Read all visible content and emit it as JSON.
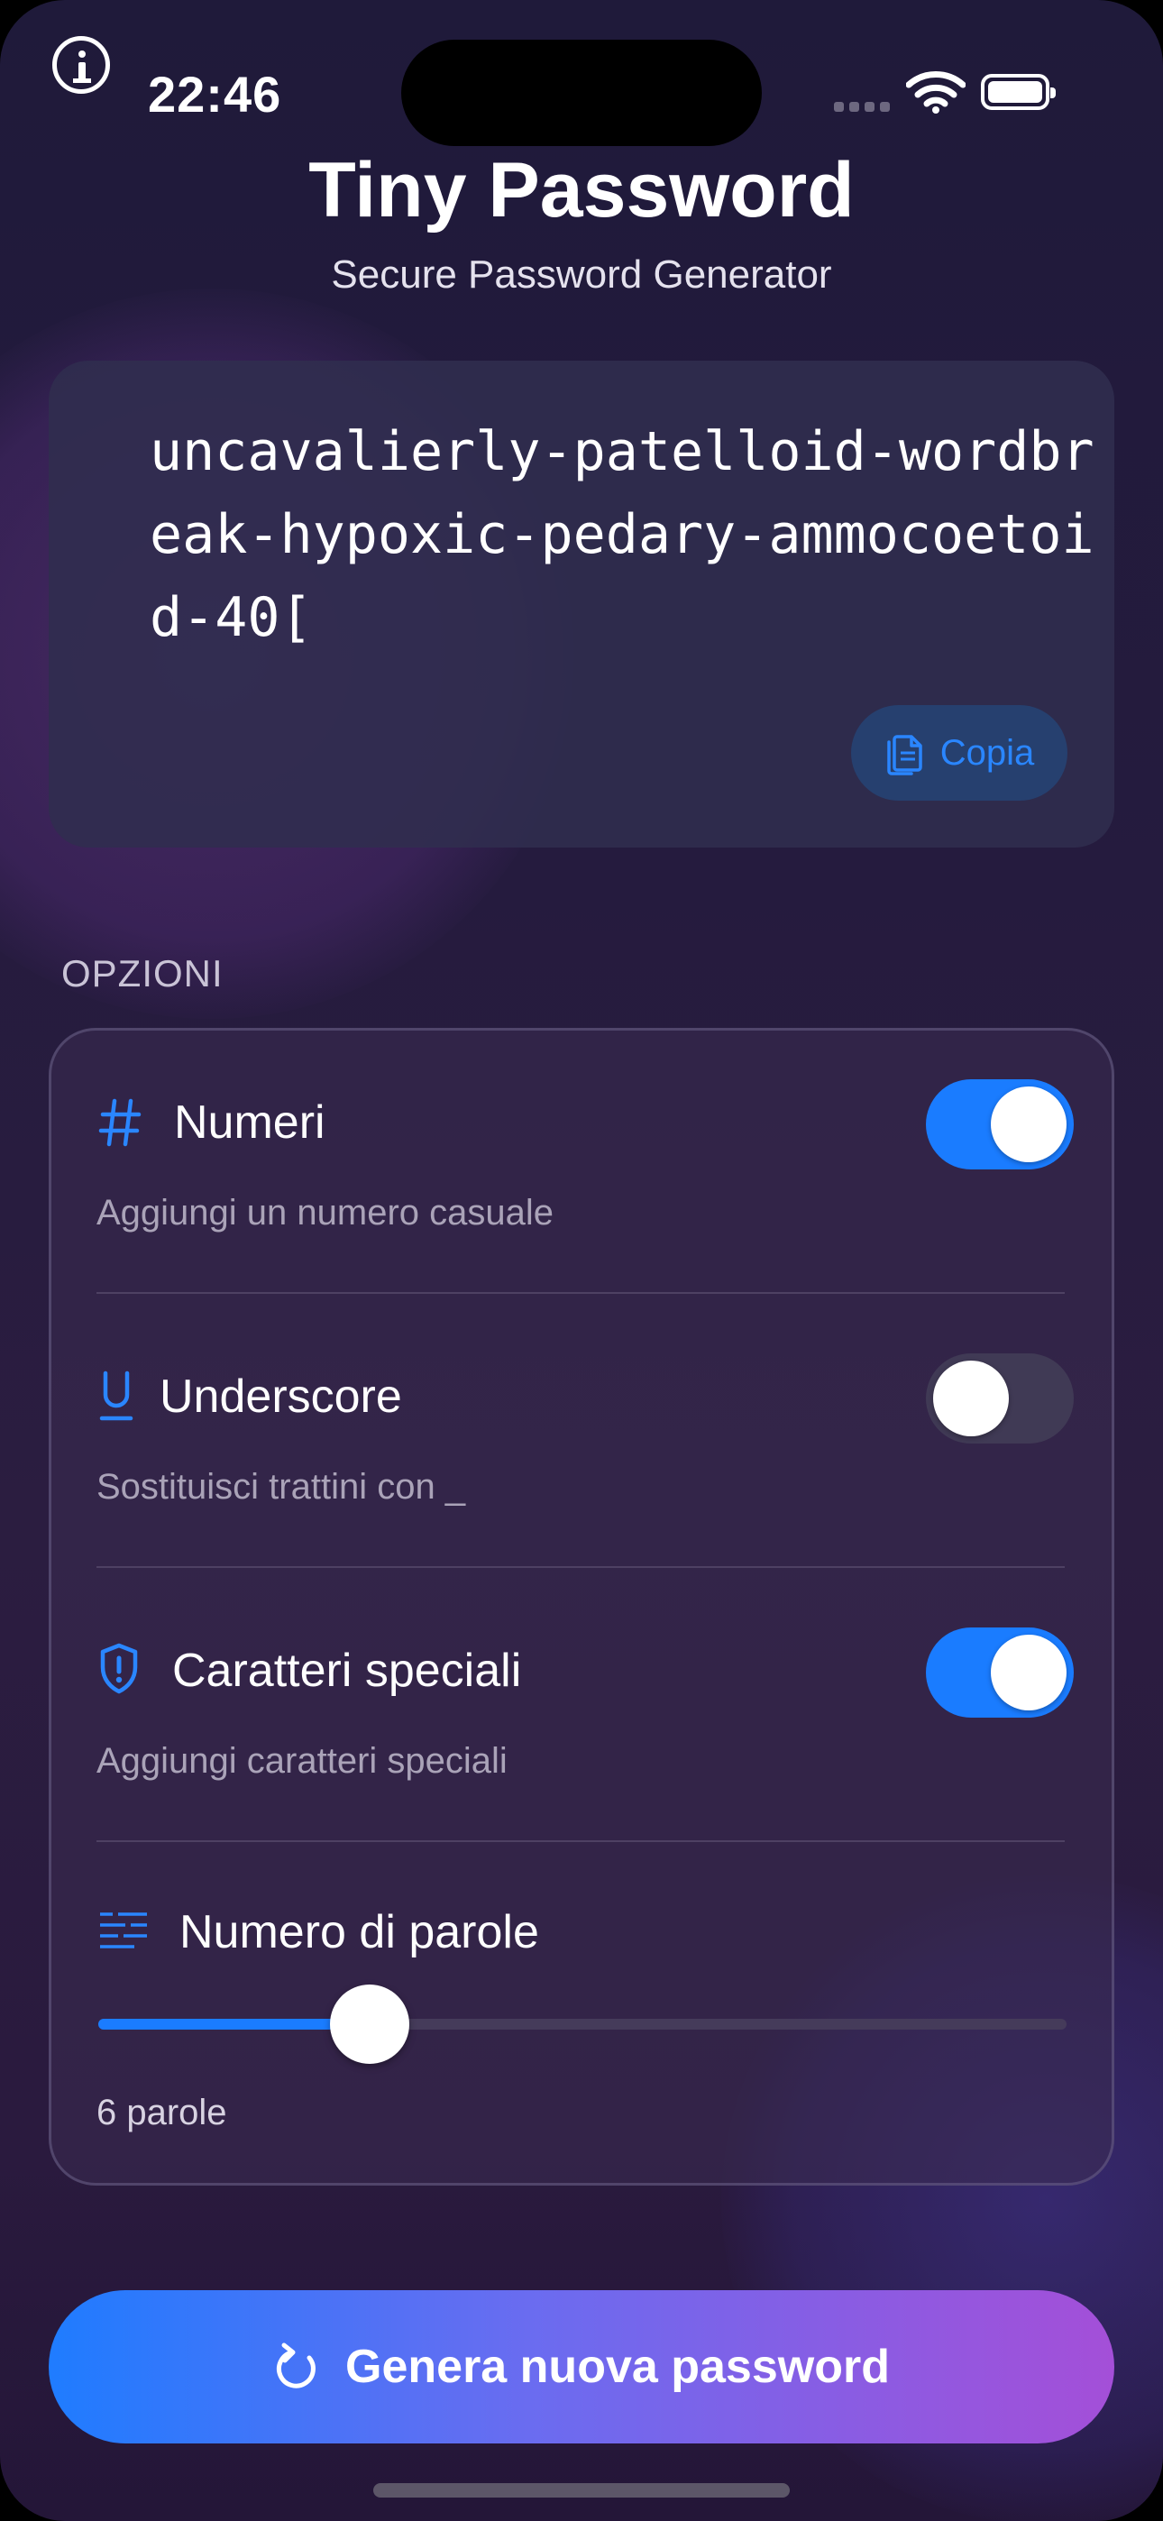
{
  "status_bar": {
    "time": "22:46"
  },
  "header": {
    "title": "Tiny Password",
    "subtitle": "Secure Password Generator"
  },
  "password": {
    "value": "uncavalierly-patelloid-wordbreak-hypoxic-pedary-ammocoetoid-40[",
    "copy_label": "Copia"
  },
  "options": {
    "section_label": "OPZIONI",
    "numbers": {
      "title": "Numeri",
      "description": "Aggiungi un numero casuale",
      "enabled": true,
      "icon": "hash-icon"
    },
    "underscore": {
      "title": "Underscore",
      "description": "Sostituisci trattini con _",
      "enabled": false,
      "icon": "underline-icon"
    },
    "special": {
      "title": "Caratteri speciali",
      "description": "Aggiungi caratteri speciali",
      "enabled": true,
      "icon": "shield-exclamation-icon"
    },
    "word_count": {
      "title": "Numero di parole",
      "value_label": "6 parole",
      "value": 6,
      "slider_fraction": 0.28,
      "icon": "text-lines-icon"
    }
  },
  "generate_button": {
    "label": "Genera nuova password",
    "icon": "refresh-icon"
  },
  "colors": {
    "accent": "#1a7cff",
    "gradient_end": "#a44fd8"
  }
}
